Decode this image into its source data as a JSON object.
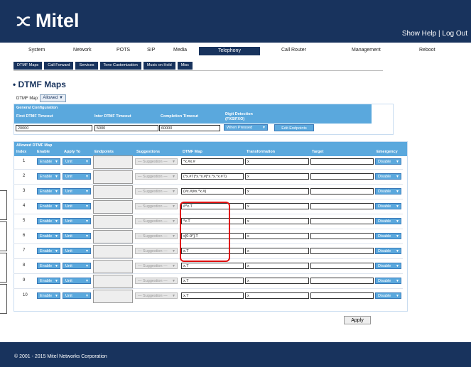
{
  "header": {
    "logo": "Mitel",
    "show_help": "Show Help",
    "sep": "|",
    "log_out": "Log Out"
  },
  "topnav": [
    "System",
    "Network",
    "POTS",
    "SIP",
    "Media",
    "Telephony",
    "Call Router",
    "Management",
    "Reboot"
  ],
  "subnav": [
    "DTMF Maps",
    "Call Forward",
    "Services",
    "Tone Customization",
    "Music on Hold",
    "Misc"
  ],
  "page_title": "• DTMF Maps",
  "dtmf_map": {
    "label": "DTMF Map:",
    "value": "Allowed"
  },
  "general": {
    "title": "General Configuration",
    "columns": [
      "First DTMF Timeout",
      "Inter DTMF Timeout",
      "Completion Timeout",
      "Digit Detection",
      "(FXS/FXO)"
    ],
    "first_timeout": "20000",
    "inter_timeout": "5000",
    "completion_timeout": "60000",
    "digit_detection": "When Pressed",
    "edit_endpoints": "Edit Endpoints"
  },
  "allowed": {
    "title": "Allowed DTMF Map",
    "columns": [
      "Index",
      "Enable",
      "Apply To",
      "Endpoints",
      "Suggestions",
      "DTMF Map",
      "Transformation",
      "Target",
      "Emergency"
    ],
    "rows": [
      {
        "index": "1",
        "enable": "Enable",
        "apply": "Unit",
        "suggest": "— Suggestion —",
        "map": "*x.#x.#",
        "trans": "x",
        "target": "",
        "emergency": "Disable"
      },
      {
        "index": "2",
        "enable": "Enable",
        "apply": "Unit",
        "suggest": "— Suggestion —",
        "map": "(*x.#T|*x.*x.#|*x.*x.*x.#T)",
        "trans": "x",
        "target": "",
        "emergency": "Disable"
      },
      {
        "index": "3",
        "enable": "Enable",
        "apply": "Unit",
        "suggest": "— Suggestion —",
        "map": "(#x.#|#x.*x.#)",
        "trans": "x",
        "target": "",
        "emergency": "Disable"
      },
      {
        "index": "4",
        "enable": "Enable",
        "apply": "Unit",
        "suggest": "— Suggestion —",
        "map": "#*x.T",
        "trans": "x",
        "target": "",
        "emergency": "Disable"
      },
      {
        "index": "5",
        "enable": "Enable",
        "apply": "Unit",
        "suggest": "— Suggestion —",
        "map": "*x.T",
        "trans": "x",
        "target": "",
        "emergency": "Disable"
      },
      {
        "index": "6",
        "enable": "Enable",
        "apply": "Unit",
        "suggest": "— Suggestion —",
        "map": "x[0-9*].T",
        "trans": "x",
        "target": "",
        "emergency": "Disable"
      },
      {
        "index": "7",
        "enable": "Enable",
        "apply": "Unit",
        "suggest": "— Suggestion —",
        "map": "x.T",
        "trans": "x",
        "target": "",
        "emergency": "Disable"
      },
      {
        "index": "8",
        "enable": "Enable",
        "apply": "Unit",
        "suggest": "— Suggestion —",
        "map": "x.T",
        "trans": "x",
        "target": "",
        "emergency": "Disable"
      },
      {
        "index": "9",
        "enable": "Enable",
        "apply": "Unit",
        "suggest": "— Suggestion —",
        "map": "x.T",
        "trans": "x",
        "target": "",
        "emergency": "Disable"
      },
      {
        "index": "10",
        "enable": "Enable",
        "apply": "Unit",
        "suggest": "— Suggestion —",
        "map": "x.T",
        "trans": "x",
        "target": "",
        "emergency": "Disable"
      }
    ]
  },
  "apply": "Apply",
  "footer": "© 2001 - 2015 Mitel Networks Corporation",
  "colors": {
    "navy": "#18335d",
    "blue": "#5aa8dd",
    "highlight": "#e01010"
  },
  "icons": [
    "mitel-logo-icon",
    "dropdown-arrow-icon"
  ]
}
